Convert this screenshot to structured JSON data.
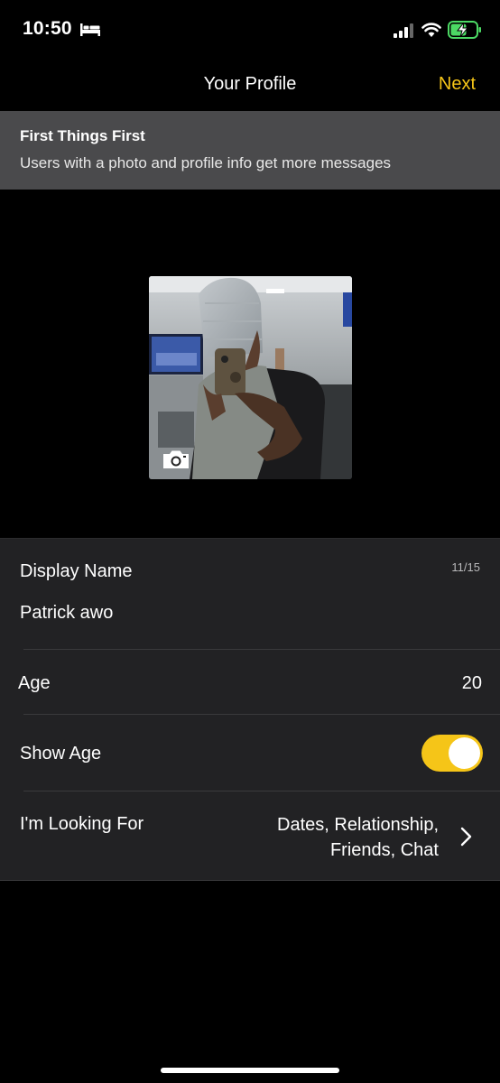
{
  "status": {
    "time": "10:50",
    "icons": [
      "bed-icon",
      "signal-icon",
      "wifi-icon",
      "battery-charging-icon"
    ]
  },
  "nav": {
    "title": "Your Profile",
    "next_label": "Next",
    "accent_color": "#f5c518"
  },
  "banner": {
    "title": "First Things First",
    "text": "Users with a photo and profile info get more messages"
  },
  "photo": {
    "camera_icon": "camera-icon"
  },
  "form": {
    "display_name": {
      "label": "Display Name",
      "counter": "11/15",
      "value": "Patrick awo"
    },
    "age": {
      "label": "Age",
      "value": "20"
    },
    "show_age": {
      "label": "Show Age",
      "enabled": true
    },
    "looking_for": {
      "label": "I'm Looking For",
      "value_line1": "Dates, Relationship,",
      "value_line2": "Friends, Chat"
    }
  }
}
